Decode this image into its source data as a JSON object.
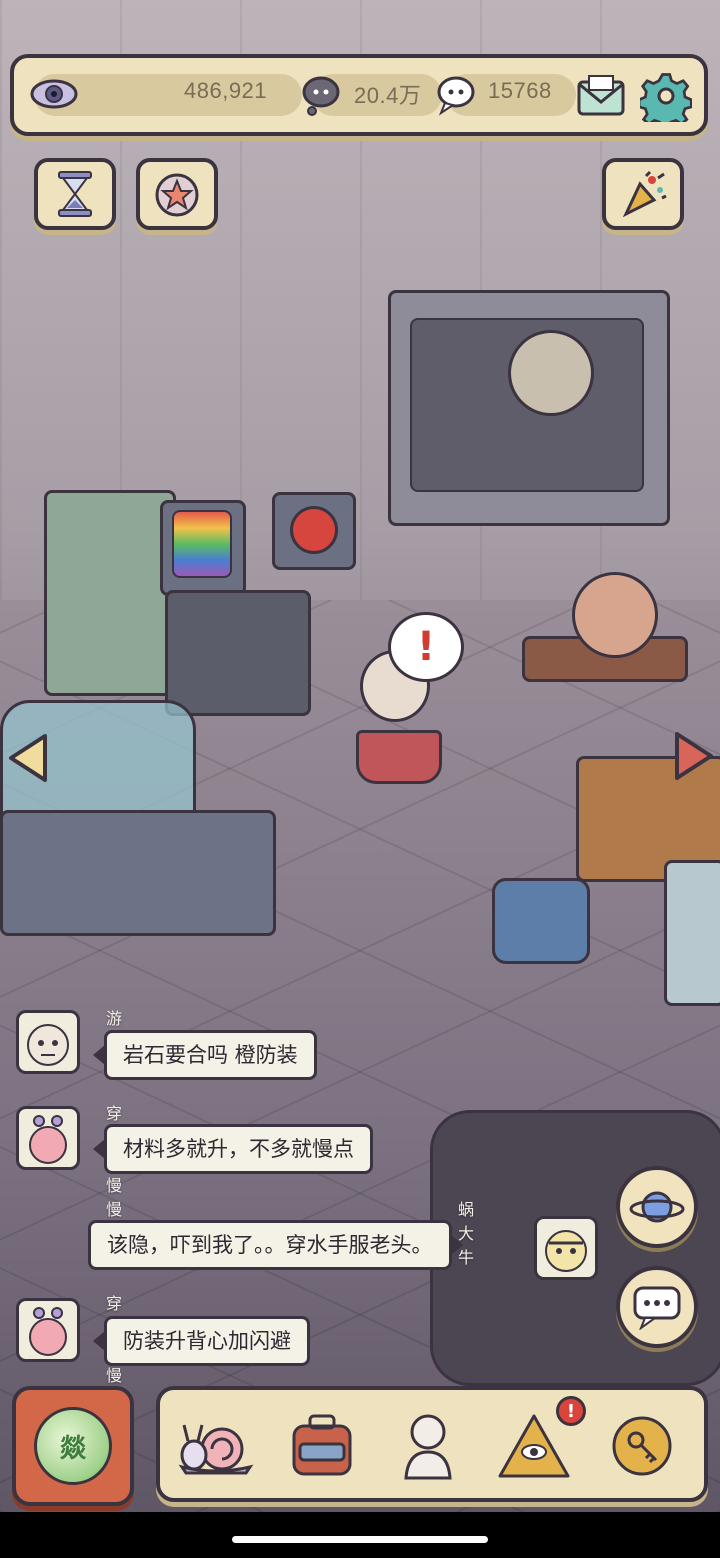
{
  "resources": {
    "views": "486,921",
    "bubbles": "20.4万",
    "messages": "15768"
  },
  "icons": {
    "eye": "eye-icon",
    "thought_bubble": "thought-bubble-icon",
    "speech_bubble": "speech-bubble-icon",
    "mail": "mail-icon",
    "settings": "gear-icon",
    "hourglass": "hourglass-icon",
    "star": "star-icon",
    "party_popper": "party-popper-icon"
  },
  "scene": {
    "alert_mark": "!"
  },
  "chat": [
    {
      "sender": "游大宝",
      "text": "岩石要合吗  橙防装",
      "side": "left"
    },
    {
      "sender": "穿越者慢慢爬",
      "text": "材料多就升，不多就慢点",
      "side": "left"
    },
    {
      "sender": "蜗大牛",
      "text": "该隐，吓到我了。。穿水手服老头。",
      "side": "right"
    },
    {
      "sender": "穿越者慢慢爬",
      "text": "防装升背心加闪避",
      "side": "left"
    }
  ],
  "bottom_nav": {
    "main_button_glyph": "燚",
    "items": [
      {
        "icon": "snail-icon"
      },
      {
        "icon": "backpack-icon"
      },
      {
        "icon": "bust-statue-icon"
      },
      {
        "icon": "pyramid-eye-icon",
        "badge": "!"
      },
      {
        "icon": "key-coin-icon"
      }
    ]
  },
  "colors": {
    "panel": "#efe3bf",
    "outline": "#3b3340",
    "accent_red": "#d9453a",
    "main_button": "#d26848"
  }
}
